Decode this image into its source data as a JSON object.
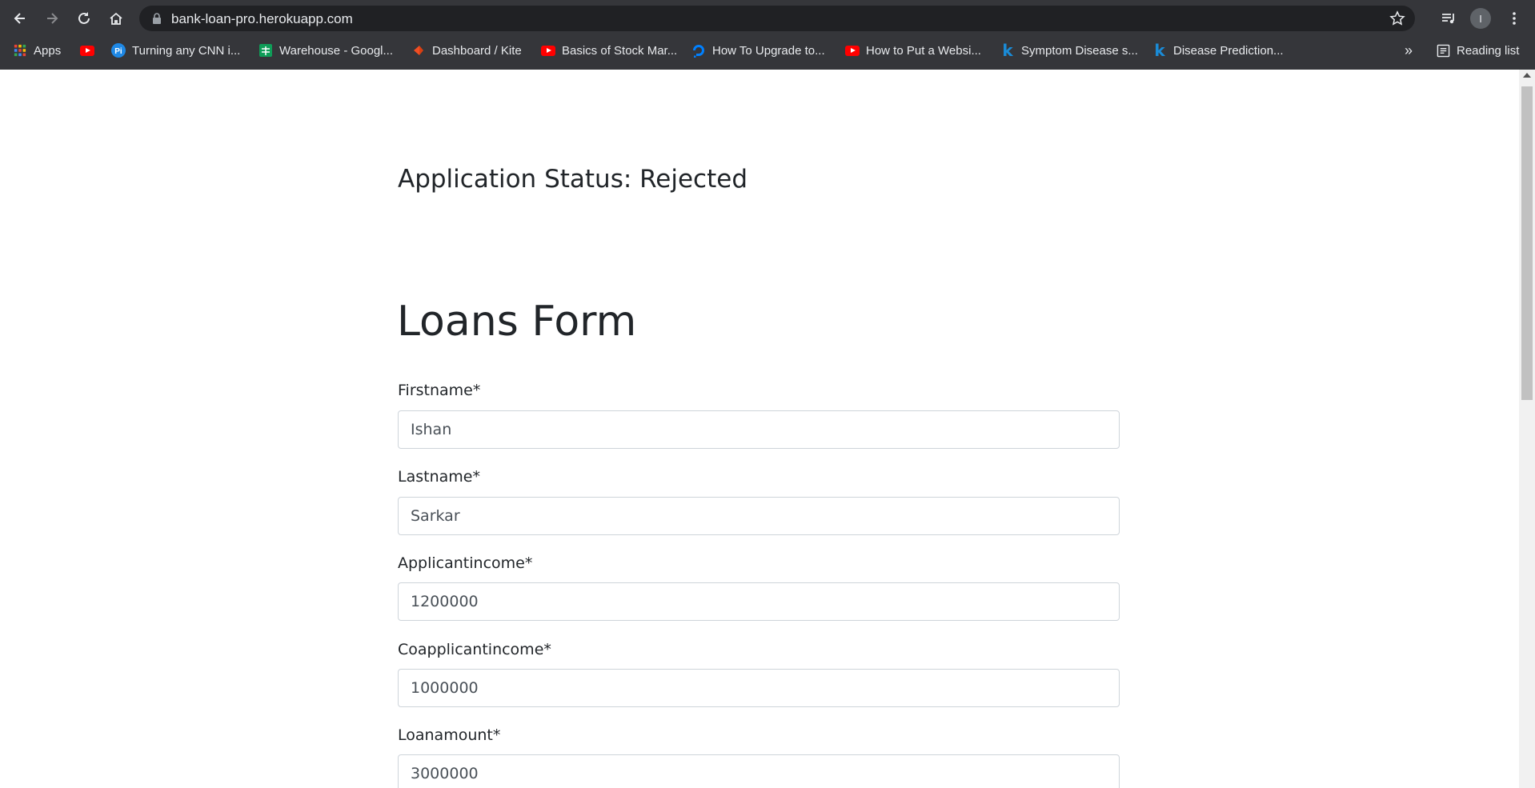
{
  "browser": {
    "url": "bank-loan-pro.herokuapp.com",
    "profile_initial": "I",
    "bookmarks": [
      {
        "label": "Apps",
        "icon": "apps-grid-icon"
      },
      {
        "label": "",
        "icon": "youtube-icon"
      },
      {
        "label": "Turning any CNN i...",
        "icon": "pi-icon"
      },
      {
        "label": "Warehouse - Googl...",
        "icon": "google-sheets-icon"
      },
      {
        "label": "Dashboard / Kite",
        "icon": "kite-icon"
      },
      {
        "label": "Basics of Stock Mar...",
        "icon": "youtube-icon"
      },
      {
        "label": "How To Upgrade to...",
        "icon": "digitalocean-icon"
      },
      {
        "label": "How to Put a Websi...",
        "icon": "youtube-icon"
      },
      {
        "label": "Symptom Disease s...",
        "icon": "kaggle-icon"
      },
      {
        "label": "Disease Prediction...",
        "icon": "kaggle-icon"
      }
    ],
    "overflow_label": "»",
    "reading_list_label": "Reading list"
  },
  "page": {
    "status_text": "Application Status: Rejected",
    "form_title": "Loans Form",
    "fields": [
      {
        "label": "Firstname*",
        "value": "Ishan"
      },
      {
        "label": "Lastname*",
        "value": "Sarkar"
      },
      {
        "label": "Applicantincome*",
        "value": "1200000"
      },
      {
        "label": "Coapplicantincome*",
        "value": "1000000"
      },
      {
        "label": "Loanamount*",
        "value": "3000000"
      }
    ]
  }
}
